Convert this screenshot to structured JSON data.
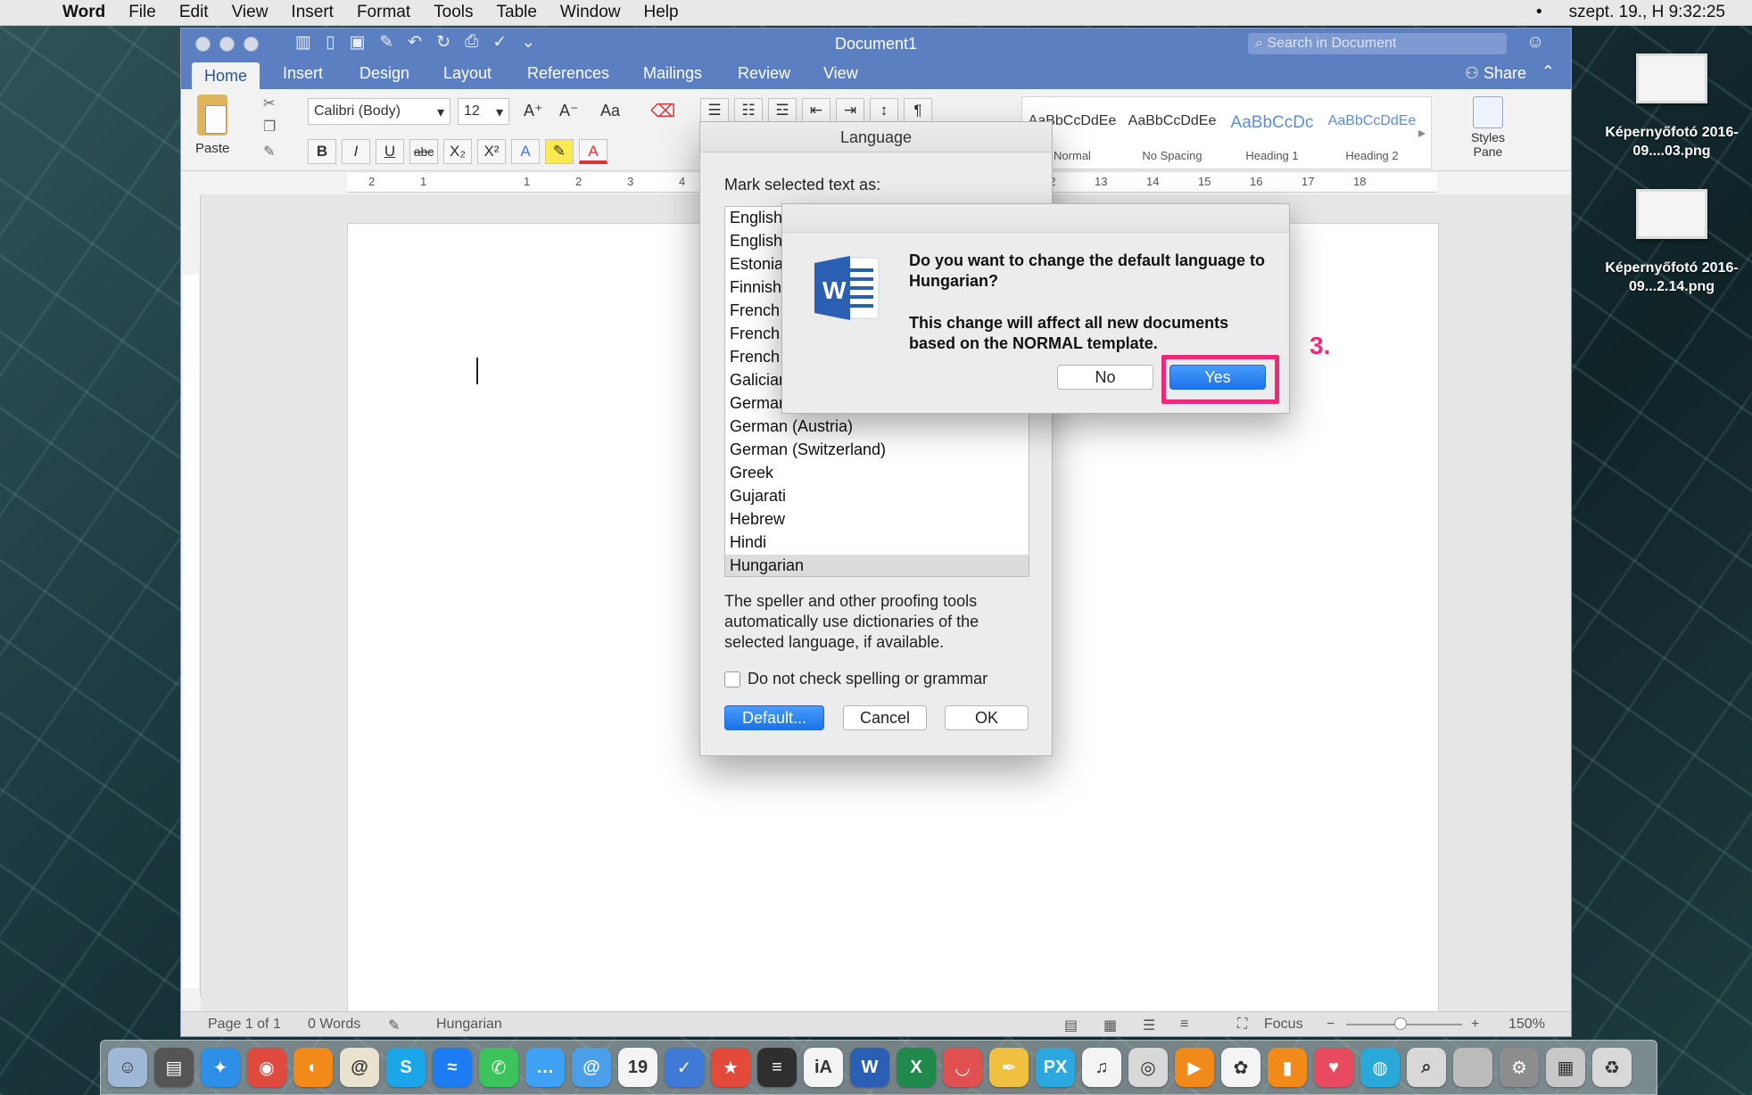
{
  "menubar": {
    "apple": "",
    "app_name": "Word",
    "items": [
      "File",
      "Edit",
      "View",
      "Insert",
      "Format",
      "Tools",
      "Table",
      "Window",
      "Help"
    ],
    "clock": "szept. 19., H  9:32:25",
    "dot": "•"
  },
  "window": {
    "title": "Document1",
    "search_placeholder": "Search in Document",
    "tabs": [
      "Home",
      "Insert",
      "Design",
      "Layout",
      "References",
      "Mailings",
      "Review",
      "View"
    ],
    "share_label": "Share",
    "font_name": "Calibri (Body)",
    "font_size": "12",
    "paste_label": "Paste",
    "format_buttons": [
      "B",
      "I",
      "U",
      "abc",
      "X₂",
      "X²"
    ],
    "styles": [
      {
        "sample": "AaBbCcDdEe",
        "name": "Normal",
        "color": "#333333"
      },
      {
        "sample": "AaBbCcDdEe",
        "name": "No Spacing",
        "color": "#333333"
      },
      {
        "sample": "AaBbCcDc",
        "name": "Heading 1",
        "color": "#5b8fd4"
      },
      {
        "sample": "AaBbCcDdEe",
        "name": "Heading 2",
        "color": "#5b8fd4"
      }
    ],
    "styles_pane_label": "Styles Pane",
    "ruler_numbers": [
      "2",
      "1",
      "",
      "1",
      "2",
      "3",
      "4",
      "",
      "",
      "",
      "",
      "",
      "",
      "",
      "",
      "",
      "12",
      "13",
      "14",
      "15",
      "16",
      "17",
      "18"
    ],
    "status": {
      "page": "Page 1 of 1",
      "words": "0 Words",
      "language": "Hungarian",
      "focus": "Focus",
      "zoom": "150%"
    }
  },
  "language_dialog": {
    "title": "Language",
    "prompt": "Mark selected text as:",
    "languages": [
      "English",
      "English",
      "Estonian",
      "Finnish",
      "French",
      "French",
      "French",
      "Galician",
      "German",
      "German (Austria)",
      "German (Switzerland)",
      "Greek",
      "Gujarati",
      "Hebrew",
      "Hindi",
      "Hungarian"
    ],
    "selected": "Hungarian",
    "description": "The speller and other proofing tools automatically use dictionaries of the selected language, if available.",
    "checkbox_label": "Do not check spelling or grammar",
    "default_button": "Default...",
    "cancel_button": "Cancel",
    "ok_button": "OK"
  },
  "alert": {
    "question": "Do you want to change the default language to Hungarian?",
    "info": "This change will affect all new documents based on the NORMAL template.",
    "no_button": "No",
    "yes_button": "Yes",
    "step_label": "3."
  },
  "desktop_icons": [
    {
      "name": "Képernyőfotó 2016-09....03.png"
    },
    {
      "name": "Képernyőfotó 2016-09...2.14.png"
    }
  ],
  "dock": [
    {
      "name": "finder",
      "color": "#9fb8d8",
      "glyph": "☺"
    },
    {
      "name": "disk-utility",
      "color": "#555555",
      "glyph": "▤"
    },
    {
      "name": "safari",
      "color": "#2e8fe6",
      "glyph": "✦"
    },
    {
      "name": "chrome",
      "color": "#e04a3f",
      "glyph": "◉"
    },
    {
      "name": "firefox",
      "color": "#f28a1a",
      "glyph": "◐"
    },
    {
      "name": "mail-stamp",
      "color": "#e8e2cf",
      "glyph": "@"
    },
    {
      "name": "skype",
      "color": "#1aa6e8",
      "glyph": "S"
    },
    {
      "name": "messenger",
      "color": "#1d7cf2",
      "glyph": "≈"
    },
    {
      "name": "phone",
      "color": "#3cc35b",
      "glyph": "✆"
    },
    {
      "name": "messages",
      "color": "#3fa1f4",
      "glyph": "…"
    },
    {
      "name": "mail",
      "color": "#4a9fe8",
      "glyph": "@"
    },
    {
      "name": "calendar",
      "color": "#f4f4f4",
      "glyph": "19"
    },
    {
      "name": "things",
      "color": "#3f7bd6",
      "glyph": "✓"
    },
    {
      "name": "wunderlist",
      "color": "#e44a3a",
      "glyph": "★"
    },
    {
      "name": "text-editor",
      "color": "#2f2f2f",
      "glyph": "≡"
    },
    {
      "name": "ia-writer",
      "color": "#f4f4f4",
      "glyph": "iA"
    },
    {
      "name": "word",
      "color": "#2b5fb4",
      "glyph": "W"
    },
    {
      "name": "excel",
      "color": "#1f8a4c",
      "glyph": "X"
    },
    {
      "name": "lips",
      "color": "#e05050",
      "glyph": "◡"
    },
    {
      "name": "pen",
      "color": "#f0c040",
      "glyph": "✒"
    },
    {
      "name": "pixelmator",
      "color": "#2ba8e0",
      "glyph": "PX"
    },
    {
      "name": "music",
      "color": "#f4f4f4",
      "glyph": "♫"
    },
    {
      "name": "podcast",
      "color": "#d8d8d8",
      "glyph": "◎"
    },
    {
      "name": "vlc",
      "color": "#f08a1a",
      "glyph": "▶"
    },
    {
      "name": "photos",
      "color": "#f4f4f4",
      "glyph": "✿"
    },
    {
      "name": "ibooks",
      "color": "#f28a1a",
      "glyph": "▮"
    },
    {
      "name": "pocket",
      "color": "#e84a5f",
      "glyph": "♥"
    },
    {
      "name": "camera",
      "color": "#2aa8d8",
      "glyph": "◍"
    },
    {
      "name": "spotlight",
      "color": "#d8d8d8",
      "glyph": "⌕"
    },
    {
      "name": "apple-store",
      "color": "#bbbbbb",
      "glyph": ""
    },
    {
      "name": "system-prefs",
      "color": "#8d8d8d",
      "glyph": "⚙"
    },
    {
      "name": "documents",
      "color": "#c8c8c8",
      "glyph": "▦"
    },
    {
      "name": "trash",
      "color": "#d8d8d8",
      "glyph": "♻"
    }
  ]
}
